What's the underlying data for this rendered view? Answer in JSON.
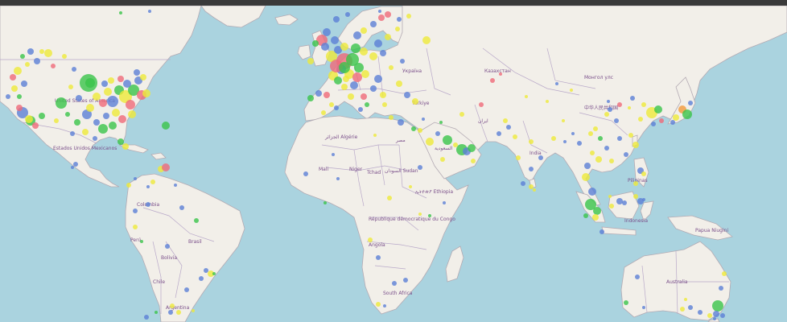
{
  "map": {
    "country_labels": [
      {
        "id": "usa",
        "text": "United States of America"
      },
      {
        "id": "mexico",
        "text": "Estados Unidos Mexicanos"
      },
      {
        "id": "colombia",
        "text": "Colombia"
      },
      {
        "id": "peru",
        "text": "Perú"
      },
      {
        "id": "bolivia",
        "text": "Bolivia"
      },
      {
        "id": "brasil",
        "text": "Brasil"
      },
      {
        "id": "chile",
        "text": "Chile"
      },
      {
        "id": "argentina",
        "text": "Argentina"
      },
      {
        "id": "algerie",
        "text": "الجزائر Algérie"
      },
      {
        "id": "mali",
        "text": "Mali"
      },
      {
        "id": "niger",
        "text": "Niger"
      },
      {
        "id": "tchad",
        "text": "Tchad"
      },
      {
        "id": "sudan",
        "text": "السودان Sudan"
      },
      {
        "id": "ethiopia",
        "text": "ኢትዮጵያ Ethiopia"
      },
      {
        "id": "rdc",
        "text": "République démocratique du Congo"
      },
      {
        "id": "angola",
        "text": "Angola"
      },
      {
        "id": "south-africa",
        "text": "South Africa"
      },
      {
        "id": "egypt",
        "text": "مصر"
      },
      {
        "id": "saudi",
        "text": "السعودية"
      },
      {
        "id": "iran",
        "text": "ایران"
      },
      {
        "id": "turkiye",
        "text": "Türkiye"
      },
      {
        "id": "ukraina",
        "text": "Україна"
      },
      {
        "id": "kazakhstan",
        "text": "Казахстан"
      },
      {
        "id": "mongolia",
        "text": "Монгол улс"
      },
      {
        "id": "china",
        "text": "中华人民共和国"
      },
      {
        "id": "india",
        "text": "India"
      },
      {
        "id": "pilipinas",
        "text": "Pilipinas"
      },
      {
        "id": "indonesia",
        "text": "Indonesia"
      },
      {
        "id": "papua",
        "text": "Papua Niugini"
      },
      {
        "id": "australia",
        "text": "Australia"
      }
    ],
    "marker_colors": {
      "blue": "#5b7fd6",
      "green": "#39c44a",
      "yellow": "#eeea3a",
      "red": "#ef6a79",
      "orange": "#f29a3a"
    },
    "colors": {
      "ocean": "#aad3df",
      "land": "#f2efe9",
      "border": "#b9a9c9",
      "label": "#7a4f8a",
      "top_bar": "#3a3a3a"
    }
  }
}
